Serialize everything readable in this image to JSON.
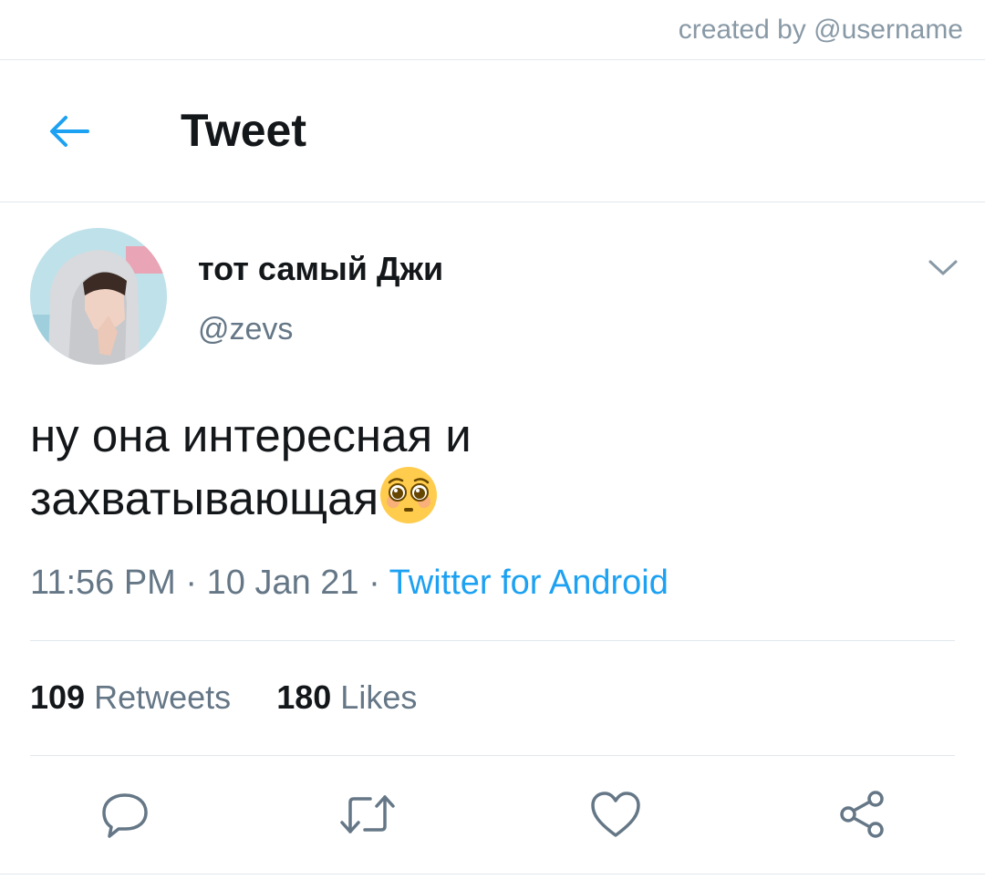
{
  "watermark": "created by @username",
  "header": {
    "title": "Tweet"
  },
  "tweet": {
    "author": {
      "display_name": "тот самый Джи",
      "handle": "@zevs"
    },
    "text_line1": "ну она интересная и",
    "text_line2": "захватывающая",
    "emoji": "pleading-face-emoji",
    "time": "11:56 PM",
    "date": "10 Jan 21",
    "source": "Twitter for Android",
    "separator": " · ",
    "stats": {
      "retweets_count": "109",
      "retweets_label": "Retweets",
      "likes_count": "180",
      "likes_label": "Likes"
    }
  },
  "icons": {
    "back": "arrow-left-icon",
    "caret": "chevron-down-icon",
    "reply": "reply-icon",
    "retweet": "retweet-icon",
    "like": "heart-icon",
    "share": "share-icon"
  },
  "colors": {
    "accent": "#1da1f2",
    "text": "#14171a",
    "secondary": "#657786",
    "border": "#e1e8ed"
  }
}
